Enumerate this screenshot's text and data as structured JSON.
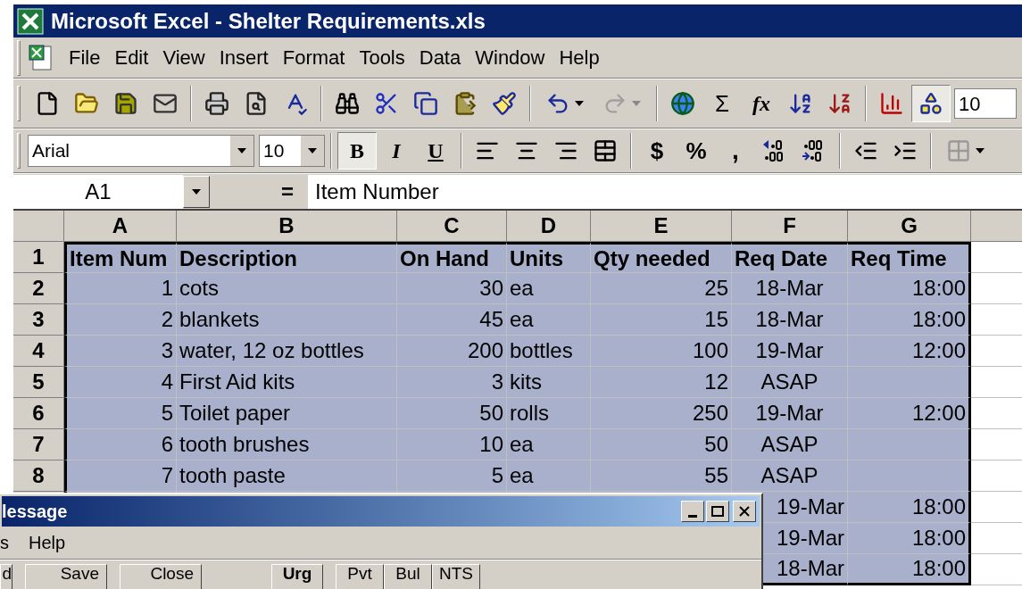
{
  "window": {
    "title": "Microsoft Excel - Shelter Requirements.xls"
  },
  "menu": [
    "File",
    "Edit",
    "View",
    "Insert",
    "Format",
    "Tools",
    "Data",
    "Window",
    "Help"
  ],
  "standard_toolbar": {
    "drawing_pressed": true,
    "zoom": "10",
    "sum": "Σ",
    "function": "fx"
  },
  "format_toolbar": {
    "font": "Arial",
    "size": "10",
    "styles": [
      {
        "label": "B",
        "pressed": true
      },
      {
        "label": "I",
        "pressed": false
      },
      {
        "label": "U",
        "pressed": false
      }
    ],
    "currency": "$",
    "percent": "%",
    "comma": ","
  },
  "formula_bar": {
    "cell": "A1",
    "equals": "=",
    "value": "Item Number"
  },
  "sheet": {
    "columns": [
      "A",
      "B",
      "C",
      "D",
      "E",
      "F",
      "G"
    ],
    "rows": [
      {
        "header": "1",
        "kind": "header",
        "selected": true,
        "cells": {
          "A": "Item Num",
          "B": "Description",
          "C": "On Hand",
          "D": "Units",
          "E": "Qty needed",
          "F": "Req Date",
          "G": "Req Time"
        }
      },
      {
        "header": "2",
        "kind": "data",
        "selected": true,
        "cells": {
          "A": "1",
          "B": "cots",
          "C": "30",
          "D": "ea",
          "E": "25",
          "F": "18-Mar",
          "G": "18:00"
        }
      },
      {
        "header": "3",
        "kind": "data",
        "selected": true,
        "cells": {
          "A": "2",
          "B": "blankets",
          "C": "45",
          "D": "ea",
          "E": "15",
          "F": "18-Mar",
          "G": "18:00"
        }
      },
      {
        "header": "4",
        "kind": "data",
        "selected": true,
        "cells": {
          "A": "3",
          "B": "water, 12 oz bottles",
          "C": "200",
          "D": "bottles",
          "E": "100",
          "F": "19-Mar",
          "G": "12:00"
        }
      },
      {
        "header": "5",
        "kind": "data",
        "selected": true,
        "cells": {
          "A": "4",
          "B": "First Aid kits",
          "C": "3",
          "D": "kits",
          "E": "12",
          "F": "ASAP"
        }
      },
      {
        "header": "6",
        "kind": "data",
        "selected": true,
        "cells": {
          "A": "5",
          "B": "Toilet paper",
          "C": "50",
          "D": "rolls",
          "E": "250",
          "F": "19-Mar",
          "G": "12:00"
        }
      },
      {
        "header": "7",
        "kind": "data",
        "selected": true,
        "cells": {
          "A": "6",
          "B": "tooth brushes",
          "C": "10",
          "D": "ea",
          "E": "50",
          "F": "ASAP"
        }
      },
      {
        "header": "8",
        "kind": "data",
        "selected": true,
        "cells": {
          "A": "7",
          "B": "tooth paste",
          "C": "5",
          "D": "ea",
          "E": "55",
          "F": "ASAP"
        }
      },
      {
        "kind": "covered",
        "selected": true,
        "cells": {
          "F": "19-Mar",
          "G": "18:00"
        }
      },
      {
        "kind": "covered",
        "selected": true,
        "cells": {
          "F": "19-Mar",
          "G": "18:00"
        }
      },
      {
        "kind": "covered",
        "selected": true,
        "cells": {
          "F": "18-Mar",
          "G": "18:00"
        }
      }
    ]
  },
  "message_window": {
    "title": "lessage",
    "menu": [
      "s",
      "Help"
    ],
    "buttons": [
      {
        "label": "d",
        "bold": false
      },
      {
        "label": "Save",
        "bold": false
      },
      {
        "label": "Close",
        "bold": false
      },
      {
        "label": "Urg",
        "bold": true
      },
      {
        "label": "Pvt",
        "bold": false
      },
      {
        "label": "Bul",
        "bold": false
      },
      {
        "label": "NTS",
        "bold": false
      }
    ]
  }
}
